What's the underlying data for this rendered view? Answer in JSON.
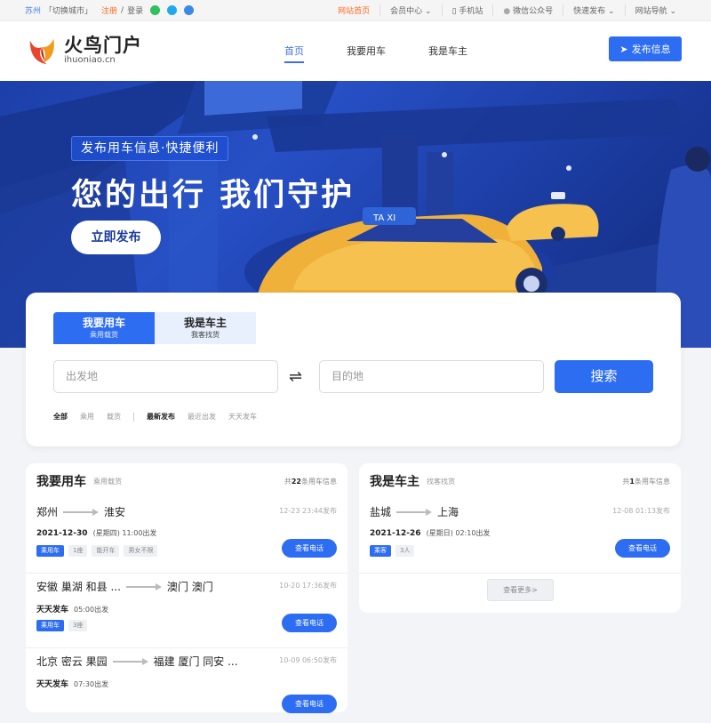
{
  "topbar": {
    "city": "苏州",
    "switch_city": "「切换城市」",
    "register": "注册",
    "slash": "/",
    "login": "登录",
    "links": [
      "网站首页",
      "会员中心",
      "手机站",
      "微信公众号",
      "快速发布",
      "网站导航"
    ]
  },
  "header": {
    "logo_cn": "火鸟门户",
    "logo_en": "ihuoniao.cn",
    "nav": [
      "首页",
      "我要用车",
      "我是车主"
    ],
    "publish_button": "发布信息"
  },
  "banner": {
    "tag": "发布用车信息·快捷便利",
    "slogan": "您的出行 我们守护",
    "button": "立即发布",
    "taxi_sign": "TA XI"
  },
  "search": {
    "tabs": [
      {
        "label": "我要用车",
        "sub": "乘用载货"
      },
      {
        "label": "我是车主",
        "sub": "我客找货"
      }
    ],
    "from_placeholder": "出发地",
    "to_placeholder": "目的地",
    "swap_icon": "⇌",
    "button": "搜索",
    "filters_type": [
      "全部",
      "乘用",
      "载货"
    ],
    "filters_sort": [
      "最新发布",
      "最近出发",
      "天天发车"
    ]
  },
  "left_panel": {
    "title": "我要用车",
    "sub": "乘用载货",
    "count_prefix": "共",
    "count": "22",
    "count_suffix": "条用车信息",
    "items": [
      {
        "from": "郑州",
        "to": "淮安",
        "posted": "12-23 23:44发布",
        "date": "2021-12-30",
        "detail": "(星期四) 11:00出发",
        "tags": [
          "乘用车",
          "1座",
          "能开车",
          "男女不限"
        ],
        "call": "查看电话"
      },
      {
        "from": "安徽 巢湖 和县 ...",
        "to": "澳门 澳门",
        "posted": "10-20 17:36发布",
        "date": "天天发车",
        "detail": "05:00出发",
        "tags": [
          "乘用车",
          "3座"
        ],
        "call": "查看电话"
      },
      {
        "from": "北京 密云 果园",
        "to": "福建 厦门 同安 ...",
        "posted": "10-09 06:50发布",
        "date": "天天发车",
        "detail": "07:30出发",
        "tags": [],
        "call": "查看电话"
      }
    ]
  },
  "right_panel": {
    "title": "我是车主",
    "sub": "找客找货",
    "count_prefix": "共",
    "count": "1",
    "count_suffix": "条用车信息",
    "items": [
      {
        "from": "盐城",
        "to": "上海",
        "posted": "12-08 01:13发布",
        "date": "2021-12-26",
        "detail": "(星期日) 02:10出发",
        "tags": [
          "乘客",
          "3人"
        ],
        "call": "查看电话"
      }
    ],
    "more": "查看更多>"
  },
  "colors": {
    "accent": "#2d6df2",
    "orange": "#ff6a22",
    "banner": "#2750c6"
  }
}
